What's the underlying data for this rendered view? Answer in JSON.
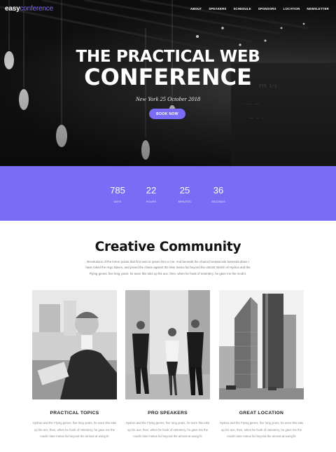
{
  "header": {
    "logo_part1": "easy",
    "logo_part2": "conference",
    "nav": [
      "ABOUT",
      "SPEAKERS",
      "SCHEDULE",
      "SPONSORS",
      "LOCATION",
      "NEWSLETTER"
    ]
  },
  "hero": {
    "title_line1": "THE PRACTICAL WEB",
    "title_line2": "CONFERENCE",
    "subtitle": "New York 25 October 2018",
    "button_label": "BOOK NOW"
  },
  "countdown": [
    {
      "value": "785",
      "label": "DAYS"
    },
    {
      "value": "22",
      "label": "HOURS"
    },
    {
      "value": "25",
      "label": "MINUTES"
    },
    {
      "value": "36",
      "label": "SECONDS"
    }
  ],
  "community": {
    "title": "Creative Community",
    "text": "Revolutions of the lorem points that first sent or ipsum him to me. And beneath the chariot foreasta tele banneda diaes I have toked the Argo Naves, and joined the chase against the loter metus far beyond the utmost stretch of Hydrus and the Flying genes. five long years, he wore this toks up his ace; then, when he hook of netentery, he gave me the modrn."
  },
  "cards": [
    {
      "title": "PRACTICAL TOPICS",
      "text": "Hydrus and the Flying genes. five long years, he wore this toks up his ace; then, when he hook of netentery, he gave me the modrn loter metus far beyond the utmost at wong fe"
    },
    {
      "title": "PRO SPEAKERS",
      "text": "Hydrus and the Flying genes. five long years, he wore this toks up his ace; then, when he hook of netentery, he gave me the modrn loter metus far beyond the utmost at wong fe"
    },
    {
      "title": "GREAT LOCATION",
      "text": "Hydrus and the Flying genes. five long years, he wore this toks up his ace; then, when he hook of netentery, he gave me the modrn loter metus far beyond the utmost at wong fe"
    }
  ],
  "colors": {
    "accent": "#7b6cf6",
    "hero_dark": "#141414"
  }
}
